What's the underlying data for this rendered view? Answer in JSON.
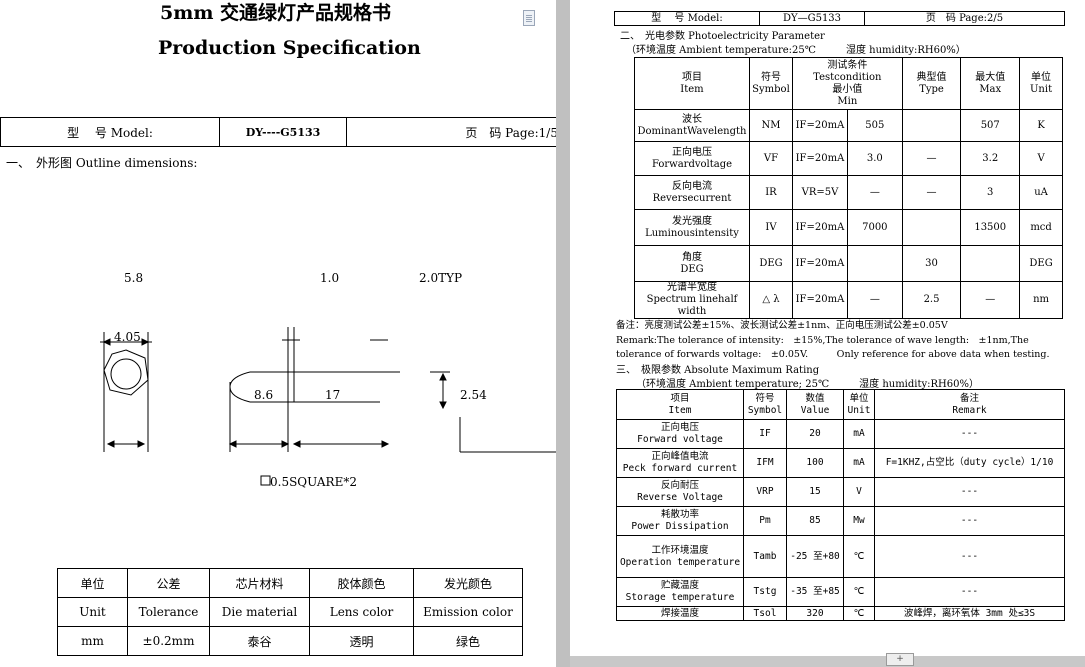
{
  "page1": {
    "title_cn": "5mm 交通绿灯产品规格书",
    "title_en": "Production Specification",
    "model_label": "型　 号 Model:",
    "model_value": "DY----G5133",
    "page_label": "页　码 Page:1/5",
    "outline_heading": "一、　外形图 Outline dimensions:",
    "dims": {
      "d1": "5.8",
      "d2": "1.0",
      "d3": "2.0TYP",
      "d4": "4.05",
      "d5": "8.6",
      "d6": "17",
      "d7": "2.54",
      "square": "0.5SQUARE*2"
    },
    "spec_table": {
      "header_cn": [
        "单位",
        "公差",
        "芯片材料",
        "胶体颜色",
        "发光颜色"
      ],
      "header_en": [
        "Unit",
        "Tolerance",
        "Die material",
        "Lens color",
        "Emission color"
      ],
      "values": [
        "mm",
        "±0.2mm",
        "泰谷",
        "透明",
        "绿色"
      ]
    }
  },
  "page2": {
    "model_label": "型　 号 Model:",
    "model_value": "DY—G5133",
    "page_label": "页　码 Page:2/5",
    "section2_title": "二、　光电参数 Photoelectricity Parameter",
    "section2_env": "（环境温度 Ambient temperature:25℃　　　湿度 humidity:RH60%）",
    "photo_header": {
      "item": [
        "项目",
        "Item"
      ],
      "symbol": [
        "符号",
        "Symbol"
      ],
      "test": [
        "测试条件",
        "Testcondition",
        "最小值",
        "Min"
      ],
      "typ": [
        "典型值",
        "Type"
      ],
      "max": [
        "最大值",
        "Max"
      ],
      "unit": [
        "单位",
        "Unit"
      ]
    },
    "photo_rows": [
      {
        "cn": "波长",
        "en": "DominantWavelength",
        "symbol": "NM",
        "cond": "IF=20mA",
        "min": "505",
        "typ": "",
        "max": "507",
        "unit": "K"
      },
      {
        "cn": "正向电压",
        "en": "Forwardvoltage",
        "symbol": "VF",
        "cond": "IF=20mA",
        "min": "3.0",
        "typ": "—",
        "max": "3.2",
        "unit": "V"
      },
      {
        "cn": "反向电流",
        "en": "Reversecurrent",
        "symbol": "IR",
        "cond": "VR=5V",
        "min": "—",
        "typ": "—",
        "max": "3",
        "unit": "uA"
      },
      {
        "cn": "发光强度",
        "en": "Luminousintensity",
        "symbol": "IV",
        "cond": "IF=20mA",
        "min": "7000",
        "typ": "",
        "max": "13500",
        "unit": "mcd"
      },
      {
        "cn": "角度",
        "en": "DEG",
        "symbol": "DEG",
        "cond": "IF=20mA",
        "min": "",
        "typ": "30",
        "max": "",
        "unit": "DEG"
      },
      {
        "cn": "光谱半宽度",
        "en": "Spectrum linehalf width",
        "symbol": "△ λ",
        "cond": "IF=20mA",
        "min": "—",
        "typ": "2.5",
        "max": "—",
        "unit": "nm"
      }
    ],
    "note_cn": "备注：亮度测试公差±15%、波长测试公差±1nm、正向电压测试公差±0.05V",
    "note_en1": "Remark:The tolerance of intensity:　±15%,The tolerance of wave length:　±1nm,The",
    "note_en2": "tolerance of forwards voltage:　±0.05V.　　　Only reference for above data when testing.",
    "section3_title": "三、　极限参数 Absolute Maximum Rating",
    "section3_env": "（环境温度 Ambient temperature; 25℃　　　湿度 humidity:RH60%）",
    "abs_header": {
      "item": [
        "项目",
        "Item"
      ],
      "symbol": [
        "符号",
        "Symbol"
      ],
      "value": [
        "数值",
        "Value"
      ],
      "unit": [
        "单位",
        "Unit"
      ],
      "remark": [
        "备注",
        "Remark"
      ]
    },
    "abs_rows": [
      {
        "cn": "正向电压",
        "en": "Forward voltage",
        "symbol": "IF",
        "value": "20",
        "unit": "mA",
        "remark": "---"
      },
      {
        "cn": "正向峰值电流",
        "en": "Peck forward current",
        "symbol": "IFM",
        "value": "100",
        "unit": "mA",
        "remark": "F=1KHZ,占空比（duty cycle）1/10"
      },
      {
        "cn": "反向耐压",
        "en": "Reverse Voltage",
        "symbol": "VRP",
        "value": "15",
        "unit": "V",
        "remark": "---"
      },
      {
        "cn": "耗散功率",
        "en": "Power Dissipation",
        "symbol": "Pm",
        "value": "85",
        "unit": "Mw",
        "remark": "---"
      },
      {
        "cn": "工作环境温度",
        "en": "Operation temperature",
        "symbol": "Tamb",
        "value": "-25 至+80",
        "unit": "℃",
        "remark": "---"
      },
      {
        "cn": "贮藏温度",
        "en": "Storage temperature",
        "symbol": "Tstg",
        "value": "-35 至+85",
        "unit": "℃",
        "remark": "---"
      },
      {
        "cn": "焊接温度",
        "en": "",
        "symbol": "Tsol",
        "value": "320",
        "unit": "℃",
        "remark": "波峰焊，离环氧体 3mm 处≤3S"
      }
    ]
  },
  "ui": {
    "pager_label": "+"
  }
}
